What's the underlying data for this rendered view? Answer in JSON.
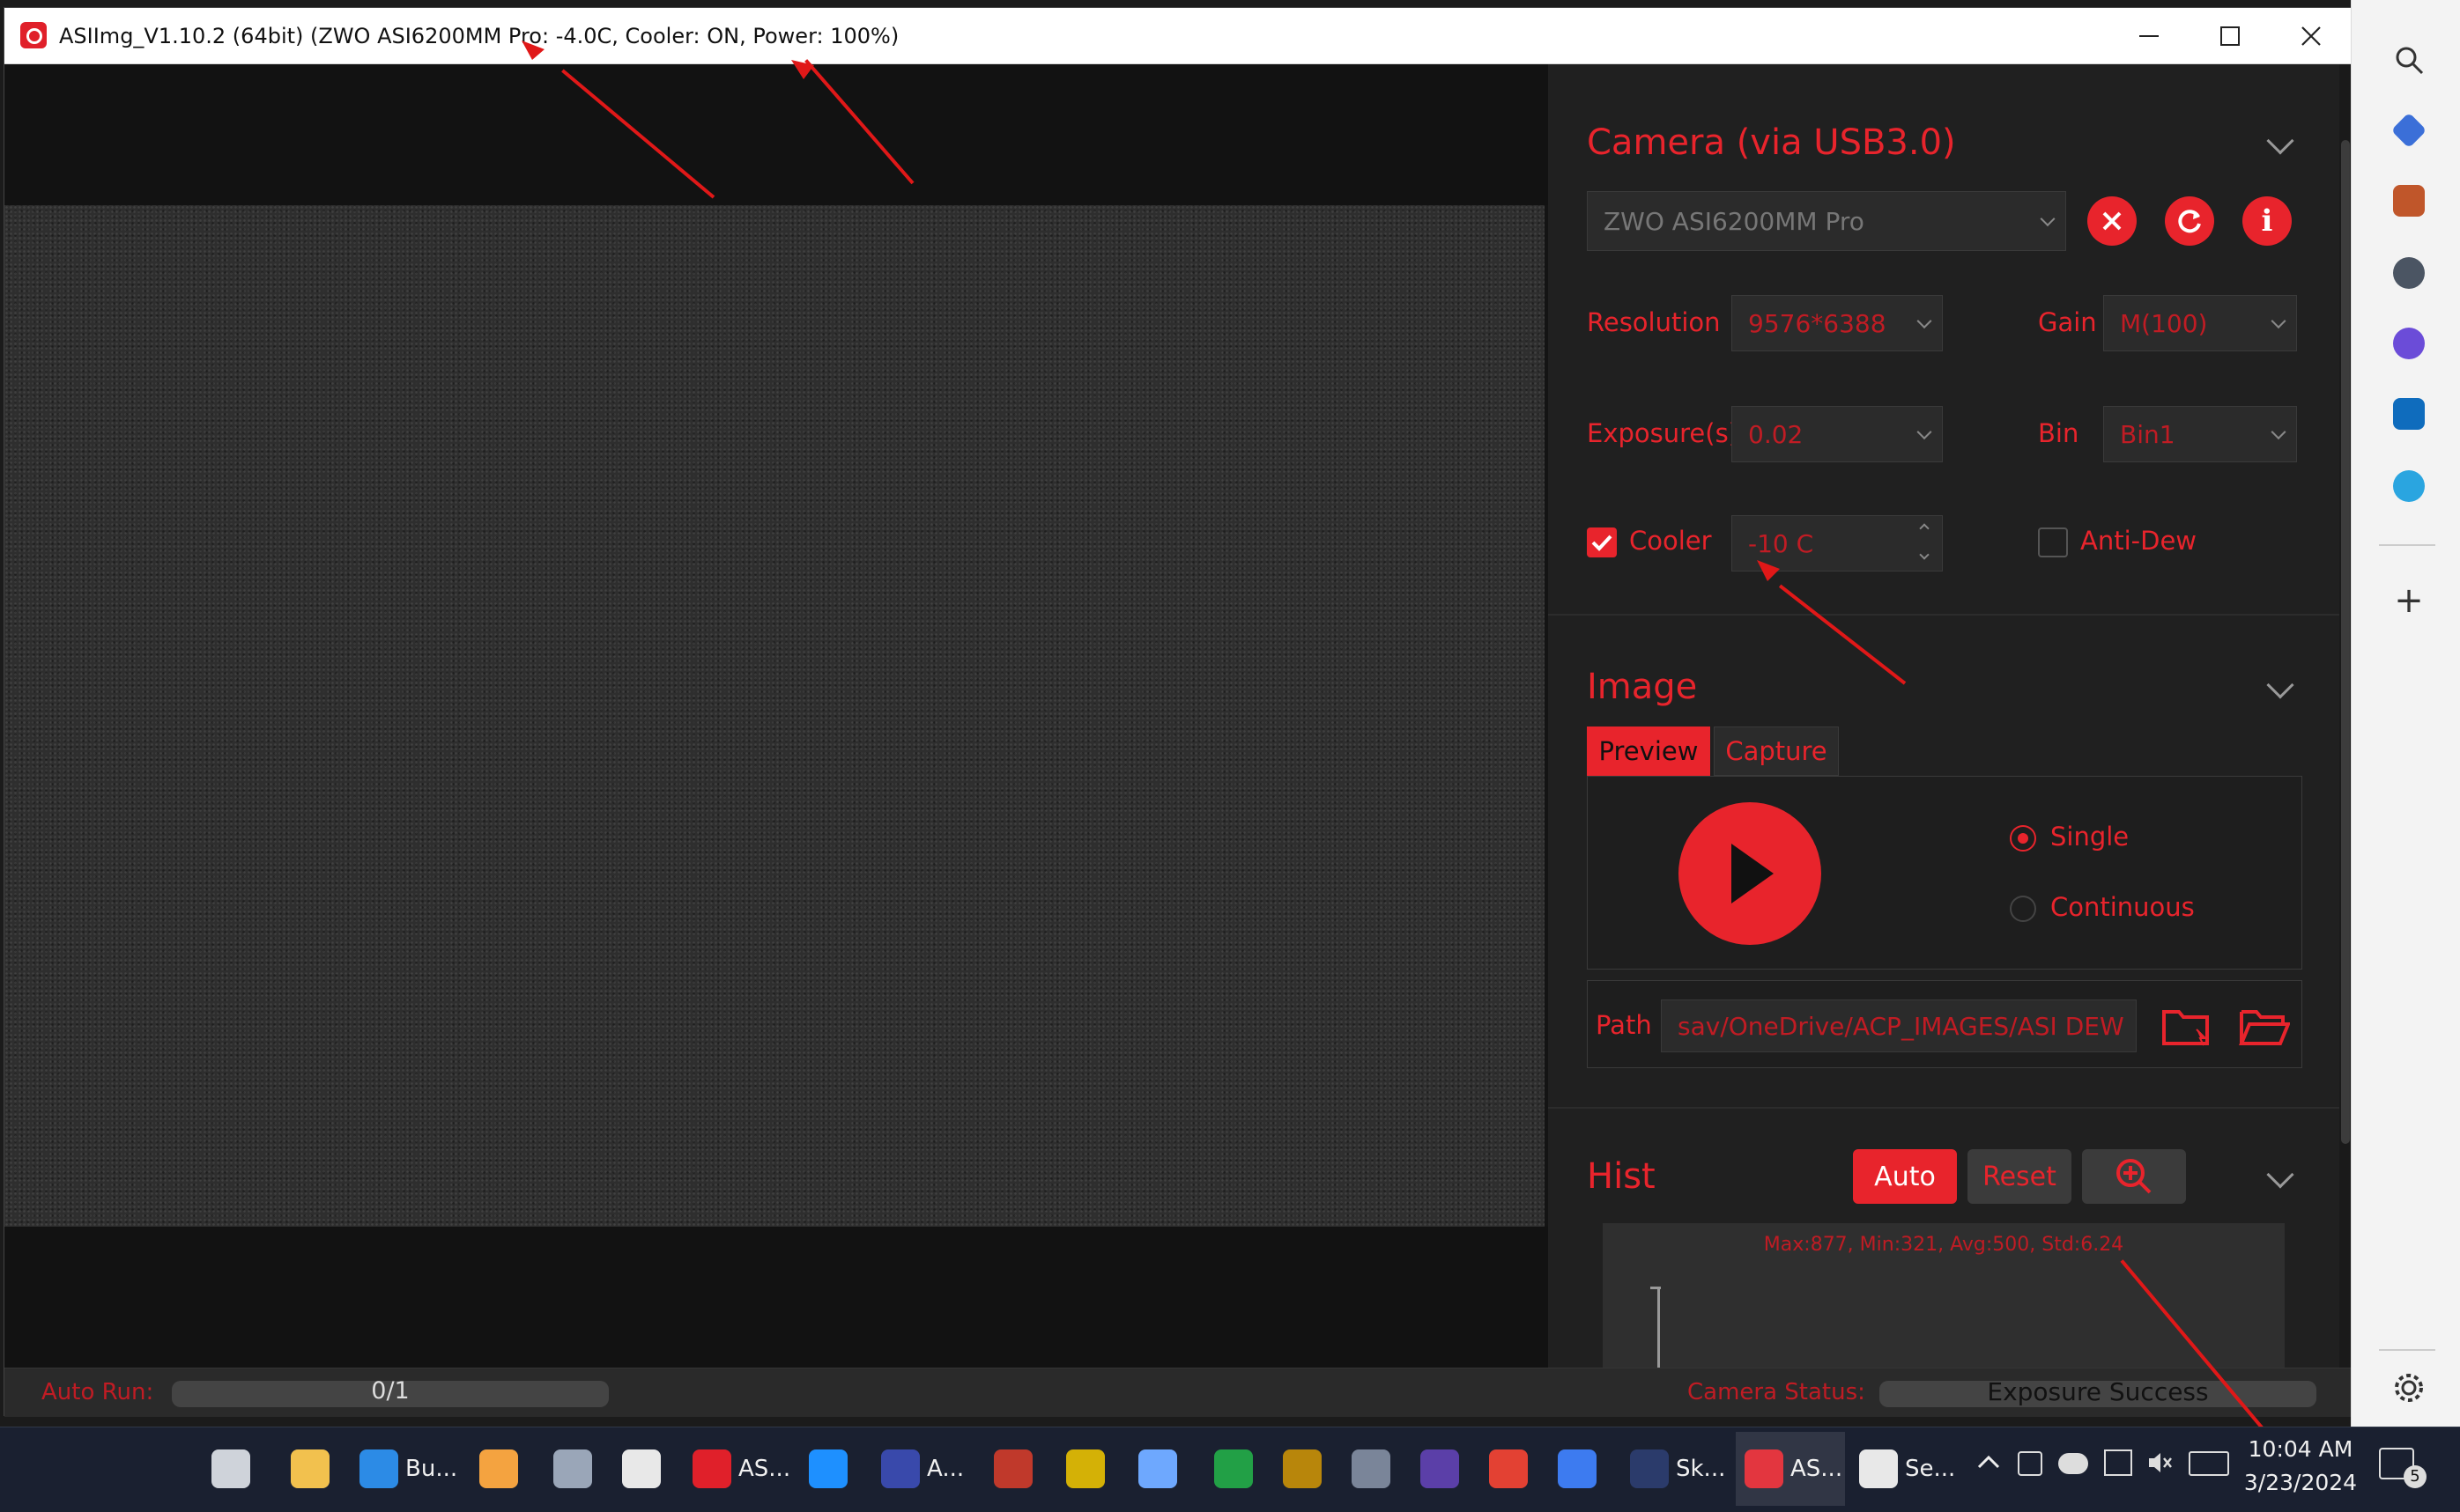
{
  "window": {
    "title": "ASIImg_V1.10.2 (64bit)  (ZWO ASI6200MM Pro: -4.0C, Cooler: ON, Power: 100%)",
    "minimize_icon": "minimize-icon",
    "maximize_icon": "maximize-icon",
    "close_icon": "close-icon"
  },
  "camera": {
    "title": "Camera (via USB3.0)",
    "model": "ZWO ASI6200MM Pro",
    "resolution_label": "Resolution",
    "resolution_value": "9576*6388",
    "gain_label": "Gain",
    "gain_value": "M(100)",
    "exposure_label": "Exposure(s)",
    "exposure_value": "0.02",
    "bin_label": "Bin",
    "bin_value": "Bin1",
    "cooler_label": "Cooler",
    "cooler_checked": true,
    "cooler_value": "-10 C",
    "antidew_label": "Anti-Dew",
    "antidew_checked": false
  },
  "image": {
    "title": "Image",
    "tabs": [
      "Preview",
      "Capture"
    ],
    "active_tab": "Preview",
    "modes": [
      "Single",
      "Continuous"
    ],
    "selected_mode": "Single",
    "path_label": "Path",
    "path_value": "sav/OneDrive/ACP_IMAGES/ASI DEW"
  },
  "hist": {
    "title": "Hist",
    "auto_label": "Auto",
    "reset_label": "Reset",
    "stats": "Max:877, Min:321, Avg:500, Std:6.24"
  },
  "status": {
    "auto_run_label": "Auto Run:",
    "auto_run_value": "0/1",
    "camera_status_label": "Camera Status:",
    "camera_status_value": "Exposure Success"
  },
  "taskbar": {
    "items": [
      {
        "icon": "task-view-icon",
        "label": ""
      },
      {
        "icon": "file-explorer-icon",
        "label": ""
      },
      {
        "icon": "edge-icon",
        "label": "Bu..."
      },
      {
        "icon": "sketch-app-icon",
        "label": ""
      },
      {
        "icon": "camera-app-icon",
        "label": ""
      },
      {
        "icon": "x-app-icon",
        "label": ""
      },
      {
        "icon": "asi-app-icon",
        "label": "AS..."
      },
      {
        "icon": "circle-app-icon",
        "label": ""
      },
      {
        "icon": "astro-app-icon",
        "label": "A..."
      },
      {
        "icon": "red-app-icon",
        "label": ""
      },
      {
        "icon": "yellow-app-icon",
        "label": ""
      },
      {
        "icon": "window-app-icon",
        "label": ""
      },
      {
        "icon": "green-app-icon",
        "label": ""
      },
      {
        "icon": "telescope-app-icon",
        "label": ""
      },
      {
        "icon": "galaxy-app-icon",
        "label": ""
      },
      {
        "icon": "planet-app-icon",
        "label": ""
      },
      {
        "icon": "chrome-icon",
        "label": ""
      },
      {
        "icon": "gem-app-icon",
        "label": ""
      },
      {
        "icon": "skytools-app-icon",
        "label": "Sk..."
      },
      {
        "icon": "asiimg-app-icon",
        "label": "AS..."
      },
      {
        "icon": "settings-app-icon",
        "label": "Se..."
      }
    ],
    "time": "10:04 AM",
    "date": "3/23/2024",
    "notification_count": "5"
  },
  "colors": {
    "accent": "#e8242c",
    "panel_bg": "#202020",
    "annotation": "#e01818"
  }
}
